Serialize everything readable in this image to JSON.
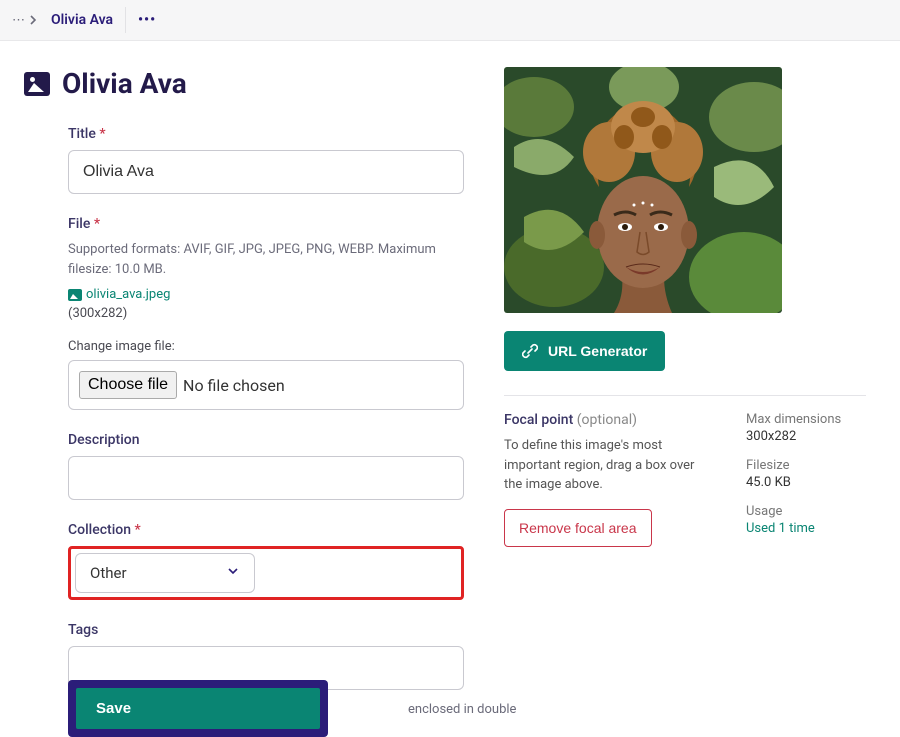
{
  "breadcrumb": {
    "title": "Olivia Ava"
  },
  "page_title": "Olivia Ava",
  "form": {
    "title_label": "Title",
    "title_value": "Olivia Ava",
    "file_label": "File",
    "file_help": "Supported formats: AVIF, GIF, JPG, JPEG, PNG, WEBP. Maximum filesize: 10.0 MB.",
    "file_link": "olivia_ava.jpeg",
    "file_dims": "(300x282)",
    "change_file_label": "Change image file:",
    "choose_file_btn": "Choose file",
    "no_file_text": "No file chosen",
    "description_label": "Description",
    "description_value": "",
    "collection_label": "Collection",
    "collection_value": "Other",
    "tags_label": "Tags",
    "tags_hint_fragment": "enclosed in double",
    "save_btn": "Save"
  },
  "right": {
    "url_gen_btn": "URL Generator",
    "focal_title": "Focal point",
    "focal_optional": "(optional)",
    "focal_desc": "To define this image's most important region, drag a box over the image above.",
    "remove_focal_btn": "Remove focal area",
    "meta": {
      "max_dim_label": "Max dimensions",
      "max_dim_val": "300x282",
      "filesize_label": "Filesize",
      "filesize_val": "45.0 KB",
      "usage_label": "Usage",
      "usage_link": "Used 1 time"
    }
  }
}
